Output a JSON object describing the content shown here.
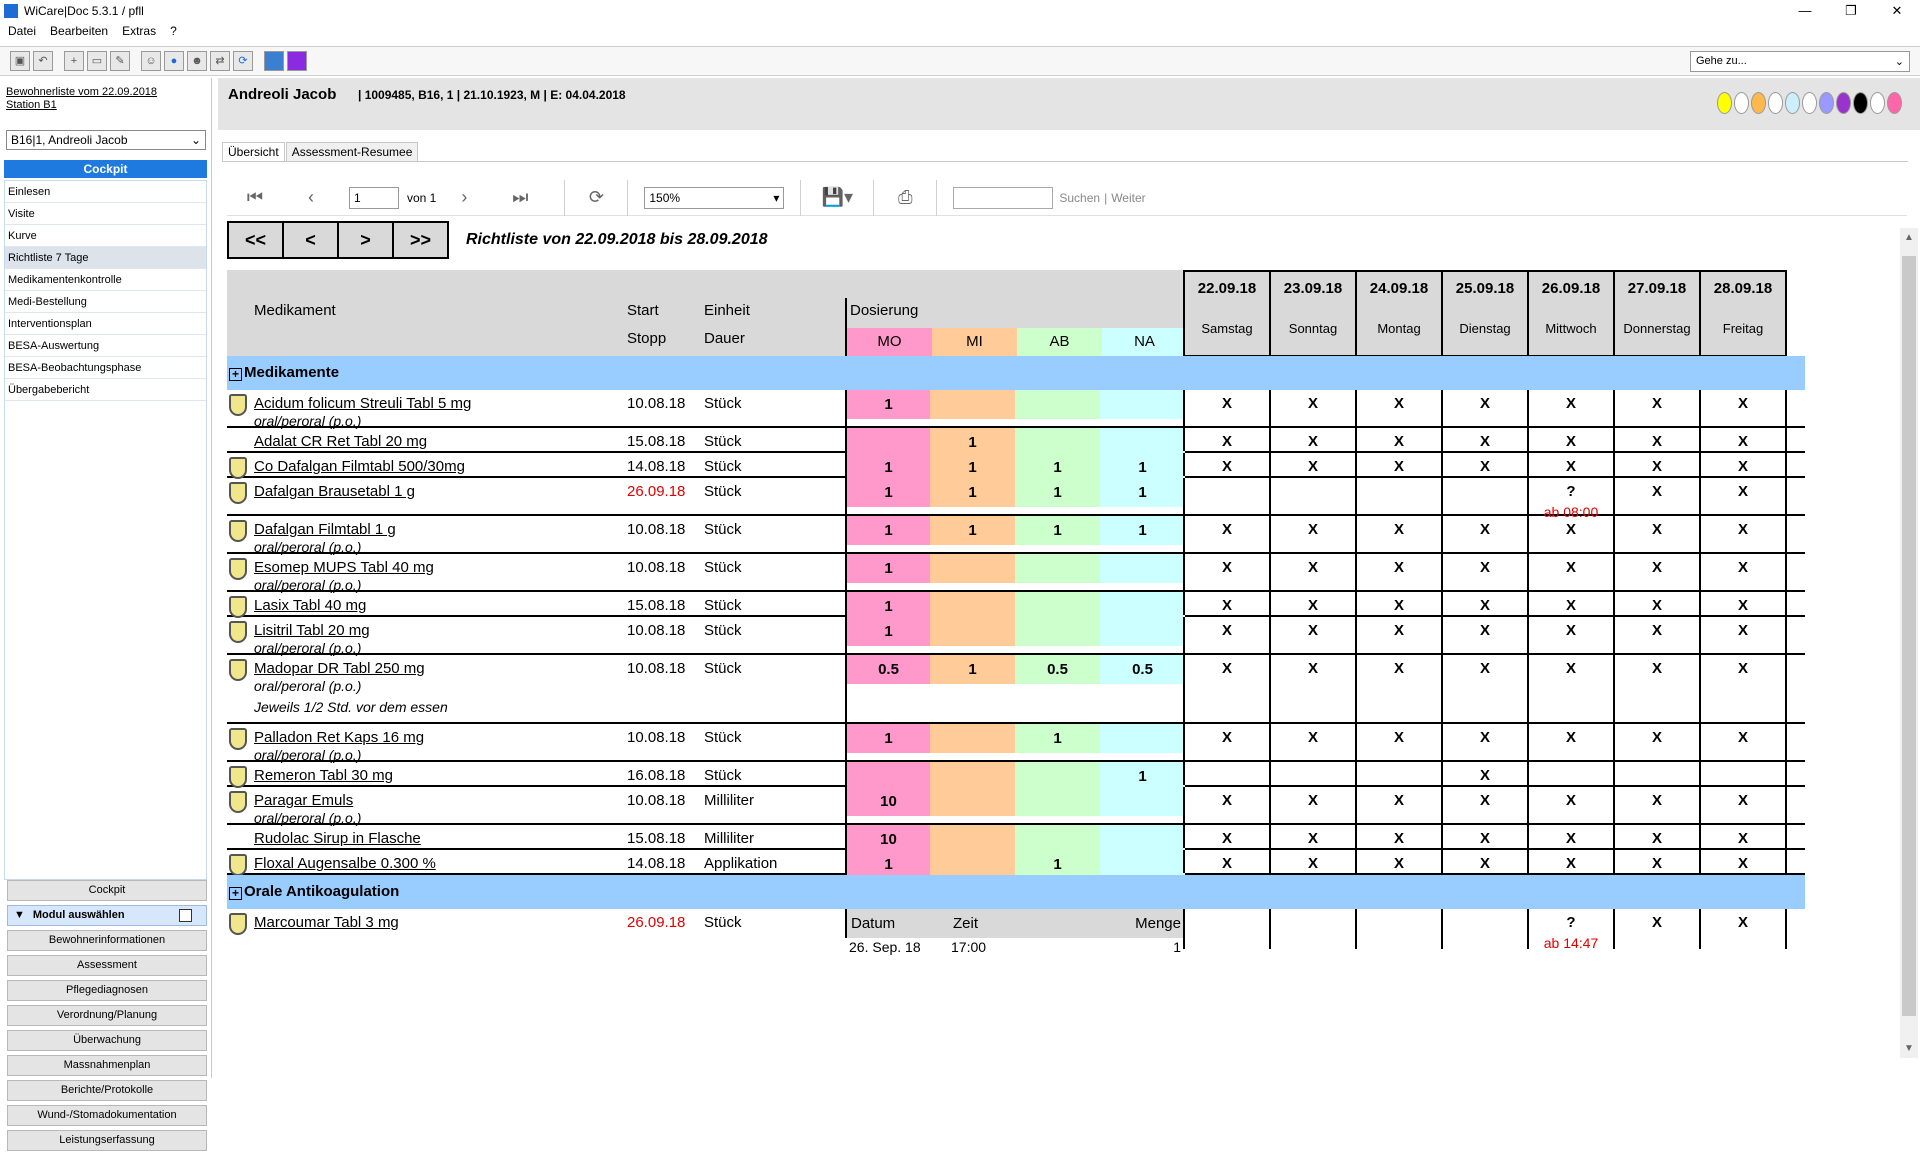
{
  "window": {
    "title": "WiCare|Doc 5.3.1  / pfll",
    "controls": [
      "—",
      "❐",
      "✕"
    ]
  },
  "menu": [
    "Datei",
    "Bearbeiten",
    "Extras",
    "?"
  ],
  "goto": {
    "label": "Gehe zu..."
  },
  "left": {
    "resident_list": "Bewohnerliste vom 22.09.2018",
    "station": "Station B1",
    "resident_select": "B16|1, Andreoli Jacob",
    "cockpit_title": "Cockpit",
    "nav": [
      "Einlesen",
      "Visite",
      "Kurve",
      "Richtliste 7 Tage",
      "Medikamentenkontrolle",
      "Medi-Bestellung",
      "Interventionsplan",
      "BESA-Auswertung",
      "BESA-Beobachtungsphase",
      "Übergabebericht"
    ],
    "modules": {
      "cockpit": "Cockpit",
      "select_label": "Modul auswählen",
      "items": [
        "Bewohnerinformationen",
        "Assessment",
        "Pflegediagnosen",
        "Verordnung/Planung",
        "Überwachung",
        "Massnahmenplan",
        "Berichte/Protokolle",
        "Wund-/Stomadokumentation",
        "Leistungserfassung"
      ]
    }
  },
  "patient": {
    "name": "Andreoli Jacob",
    "info": "| 1009485, B16, 1 | 21.10.1923, M | E: 04.04.2018",
    "dot_colors": [
      "#ffff00",
      "#ffffff",
      "#ffb84d",
      "#ffffff",
      "#cceeff",
      "#ffffff",
      "#9999ff",
      "#9933cc",
      "#000000",
      "#ffffff",
      "#ff66aa"
    ]
  },
  "tabs": [
    "Übersicht",
    "Assessment-Resumee"
  ],
  "report_toolbar": {
    "page": "1",
    "of": "von 1",
    "zoom": "150%",
    "search": "Suchen",
    "next": "Weiter",
    "sep": "|"
  },
  "nav_buttons": [
    "<<",
    "<",
    ">",
    ">>"
  ],
  "report_title": "Richtliste von 22.09.2018 bis 28.09.2018",
  "table": {
    "headers": {
      "med": "Medikament",
      "start": "Start",
      "stop": "Stopp",
      "unit": "Einheit",
      "duration": "Dauer",
      "dosing": "Dosierung",
      "mo": "MO",
      "mi": "MI",
      "ab": "AB",
      "na": "NA"
    },
    "days": [
      {
        "date": "22.09.18",
        "name": "Samstag"
      },
      {
        "date": "23.09.18",
        "name": "Sonntag"
      },
      {
        "date": "24.09.18",
        "name": "Montag"
      },
      {
        "date": "25.09.18",
        "name": "Dienstag"
      },
      {
        "date": "26.09.18",
        "name": "Mittwoch"
      },
      {
        "date": "27.09.18",
        "name": "Donnerstag"
      },
      {
        "date": "28.09.18",
        "name": "Freitag"
      }
    ],
    "section1": "Medikamente",
    "section2": "Orale Antikoagulation",
    "rows": [
      {
        "name": "Acidum folicum Streuli Tabl 5 mg",
        "route": "oral/peroral (p.o.)",
        "start": "10.08.18",
        "unit": "Stück",
        "mo": "1",
        "mi": "",
        "ab": "",
        "na": "",
        "marks": [
          "X",
          "X",
          "X",
          "X",
          "X",
          "X",
          "X"
        ]
      },
      {
        "name": "Adalat CR Ret Tabl 20 mg",
        "route": "",
        "start": "15.08.18",
        "unit": "Stück",
        "mo": "",
        "mi": "1",
        "ab": "",
        "na": "",
        "marks": [
          "X",
          "X",
          "X",
          "X",
          "X",
          "X",
          "X"
        ]
      },
      {
        "name": "Co Dafalgan Filmtabl 500/30mg",
        "route": "",
        "start": "14.08.18",
        "unit": "Stück",
        "mo": "1",
        "mi": "1",
        "ab": "1",
        "na": "1",
        "marks": [
          "X",
          "X",
          "X",
          "X",
          "X",
          "X",
          "X"
        ]
      },
      {
        "name": "Dafalgan Brausetabl 1 g",
        "route": "",
        "start": "26.09.18",
        "unit": "Stück",
        "mo": "1",
        "mi": "1",
        "ab": "1",
        "na": "1",
        "marks": [
          "",
          "",
          "",
          "",
          "?",
          "X",
          "X"
        ],
        "note_day": "ab 08:00"
      },
      {
        "name": "Dafalgan Filmtabl 1 g",
        "route": "oral/peroral (p.o.)",
        "start": "10.08.18",
        "unit": "Stück",
        "mo": "1",
        "mi": "1",
        "ab": "1",
        "na": "1",
        "marks": [
          "X",
          "X",
          "X",
          "X",
          "X",
          "X",
          "X"
        ]
      },
      {
        "name": "Esomep MUPS Tabl 40 mg",
        "route": "oral/peroral (p.o.)",
        "start": "10.08.18",
        "unit": "Stück",
        "mo": "1",
        "mi": "",
        "ab": "",
        "na": "",
        "marks": [
          "X",
          "X",
          "X",
          "X",
          "X",
          "X",
          "X"
        ]
      },
      {
        "name": "Lasix Tabl 40 mg",
        "route": "",
        "start": "15.08.18",
        "unit": "Stück",
        "mo": "1",
        "mi": "",
        "ab": "",
        "na": "",
        "marks": [
          "X",
          "X",
          "X",
          "X",
          "X",
          "X",
          "X"
        ]
      },
      {
        "name": "Lisitril Tabl 20 mg",
        "route": "oral/peroral (p.o.)",
        "start": "10.08.18",
        "unit": "Stück",
        "mo": "1",
        "mi": "",
        "ab": "",
        "na": "",
        "marks": [
          "X",
          "X",
          "X",
          "X",
          "X",
          "X",
          "X"
        ]
      },
      {
        "name": "Madopar DR Tabl 250 mg",
        "route": "oral/peroral (p.o.)",
        "start": "10.08.18",
        "unit": "Stück",
        "mo": "0.5",
        "mi": "1",
        "ab": "0.5",
        "na": "0.5",
        "marks": [
          "X",
          "X",
          "X",
          "X",
          "X",
          "X",
          "X"
        ],
        "note": "Jeweils 1/2 Std. vor dem essen"
      },
      {
        "name": "Palladon Ret Kaps 16 mg",
        "route": "oral/peroral (p.o.)",
        "start": "10.08.18",
        "unit": "Stück",
        "mo": "1",
        "mi": "",
        "ab": "1",
        "na": "",
        "marks": [
          "X",
          "X",
          "X",
          "X",
          "X",
          "X",
          "X"
        ]
      },
      {
        "name": "Remeron Tabl 30 mg",
        "route": "",
        "start": "16.08.18",
        "unit": "Stück",
        "mo": "",
        "mi": "",
        "ab": "",
        "na": "1",
        "marks": [
          "",
          "",
          "",
          "X",
          "",
          "",
          ""
        ]
      },
      {
        "name": "Paragar Emuls",
        "route": "oral/peroral (p.o.)",
        "start": "10.08.18",
        "unit": "Milliliter",
        "mo": "10",
        "mi": "",
        "ab": "",
        "na": "",
        "marks": [
          "X",
          "X",
          "X",
          "X",
          "X",
          "X",
          "X"
        ]
      },
      {
        "name": "Rudolac Sirup in Flasche",
        "route": "",
        "start": "15.08.18",
        "unit": "Milliliter",
        "mo": "10",
        "mi": "",
        "ab": "",
        "na": "",
        "marks": [
          "X",
          "X",
          "X",
          "X",
          "X",
          "X",
          "X"
        ]
      },
      {
        "name": "Floxal Augensalbe 0.300 %",
        "route": "",
        "start": "14.08.18",
        "unit": "Applikation",
        "mo": "1",
        "mi": "",
        "ab": "1",
        "na": "",
        "marks": [
          "X",
          "X",
          "X",
          "X",
          "X",
          "X",
          "X"
        ]
      }
    ],
    "anticoag": {
      "name": "Marcoumar Tabl 3 mg",
      "start": "26.09.18",
      "unit": "Stück",
      "cols": {
        "date": "Datum",
        "time": "Zeit",
        "amount": "Menge"
      },
      "entry": {
        "date": "26. Sep. 18",
        "time": "17:00",
        "amount": "1"
      },
      "marks": [
        "",
        "",
        "",
        "",
        "?",
        "X",
        "X"
      ],
      "note_day": "ab 14:47"
    }
  }
}
